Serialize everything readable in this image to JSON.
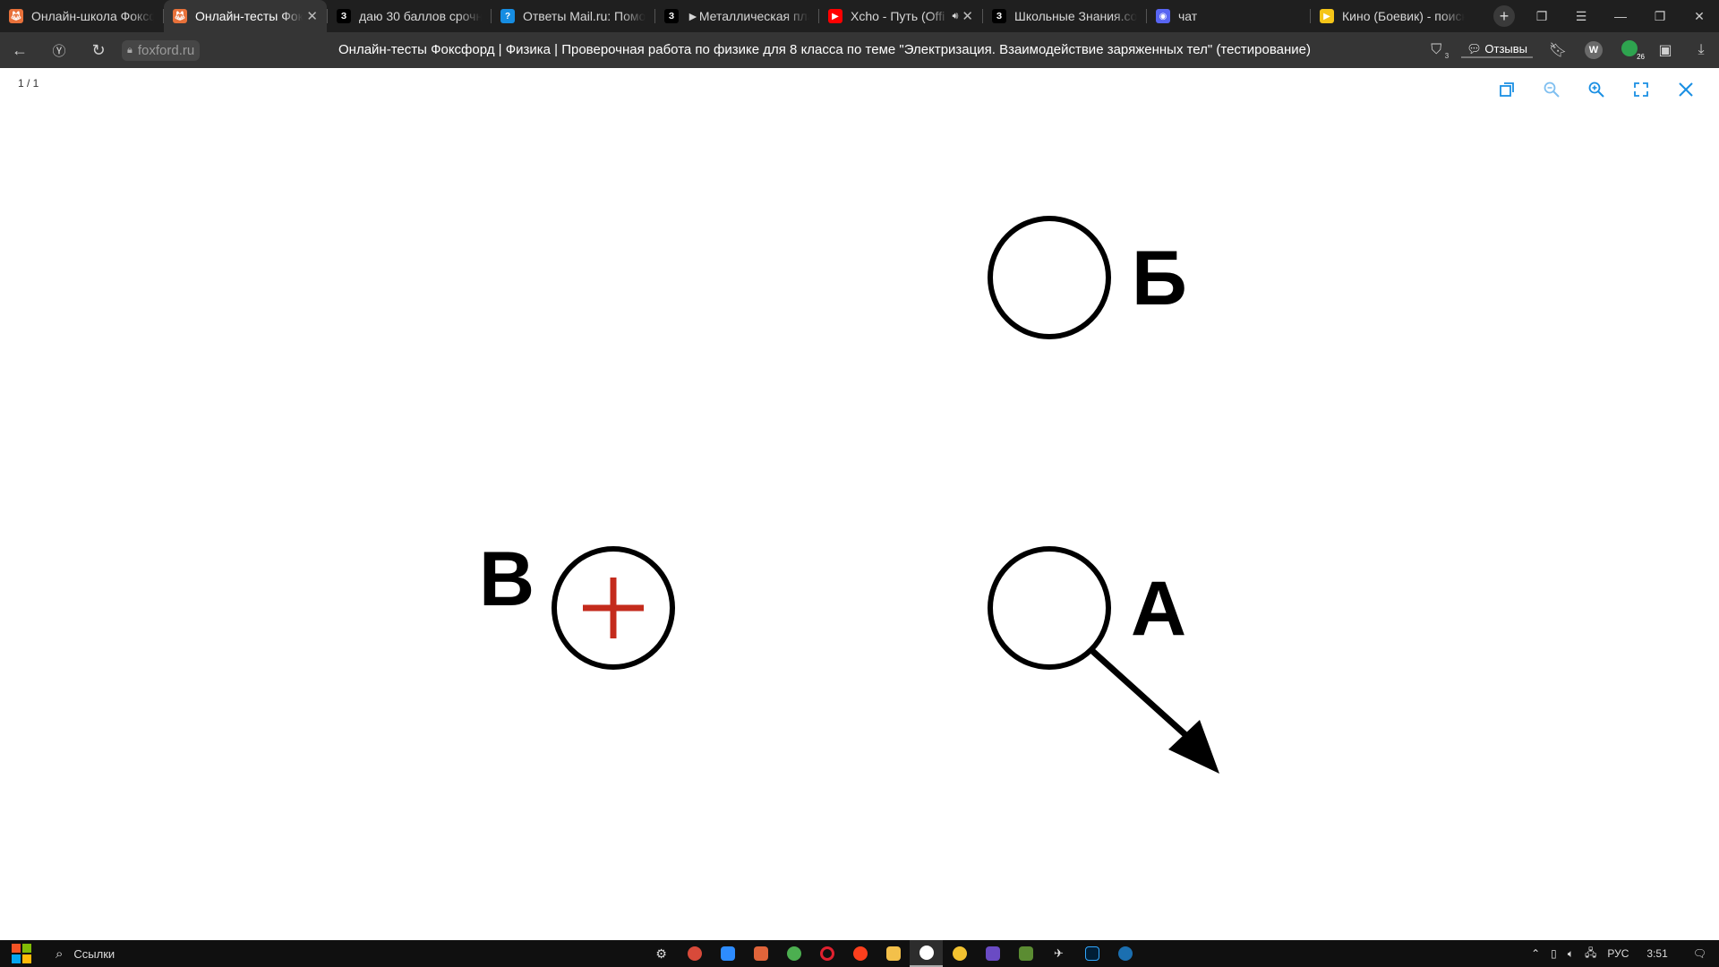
{
  "tabs": [
    {
      "title": "Онлайн-школа Фоксф",
      "icon": "fox-icon",
      "color": "#e8713a",
      "active": false
    },
    {
      "title": "Онлайн-тесты Фокс",
      "icon": "fox-icon",
      "color": "#e8713a",
      "active": true
    },
    {
      "title": "даю 30 баллов срочн",
      "icon": "znanija-icon",
      "color": "#000000",
      "active": false
    },
    {
      "title": "Ответы Mail.ru: Помо",
      "icon": "mail-answers-icon",
      "color": "#168de2",
      "active": false
    },
    {
      "title": "►Металлическая пла",
      "icon": "znanija-icon",
      "color": "#000000",
      "active": false
    },
    {
      "title": "Xcho - Путь (Offi",
      "icon": "youtube-icon",
      "color": "#ff0000",
      "active": false
    },
    {
      "title": "Школьные Знания.com",
      "icon": "znanija-icon",
      "color": "#000000",
      "active": false
    },
    {
      "title": "чат",
      "icon": "discord-icon",
      "color": "#5865f2",
      "active": false
    },
    {
      "title": "Кино (Боевик) - поиск",
      "icon": "kinopoisk-icon",
      "color": "#f5c518",
      "active": false
    }
  ],
  "address": {
    "domain": "foxford.ru",
    "page_title": "Онлайн-тесты Фоксфорд | Физика | Проверочная работа по физике для 8 класса по теме \"Электризация. Взаимодействие заряженных тел\" (тестирование)",
    "reviews_label": "Отзывы",
    "extension_w": "W",
    "extension_badge": "26",
    "ext_count": "3"
  },
  "viewer": {
    "page_counter": "1 / 1",
    "tools": [
      "copy-icon",
      "zoom-out-icon",
      "zoom-in-icon",
      "fullscreen-icon",
      "close-icon"
    ]
  },
  "figure": {
    "label_b": "Б",
    "label_v": "В",
    "label_a": "А",
    "plus_color": "#c42b1c",
    "stroke_color": "#000000"
  },
  "taskbar": {
    "search_label": "Ссылки",
    "language": "РУС",
    "time": "3:51"
  }
}
